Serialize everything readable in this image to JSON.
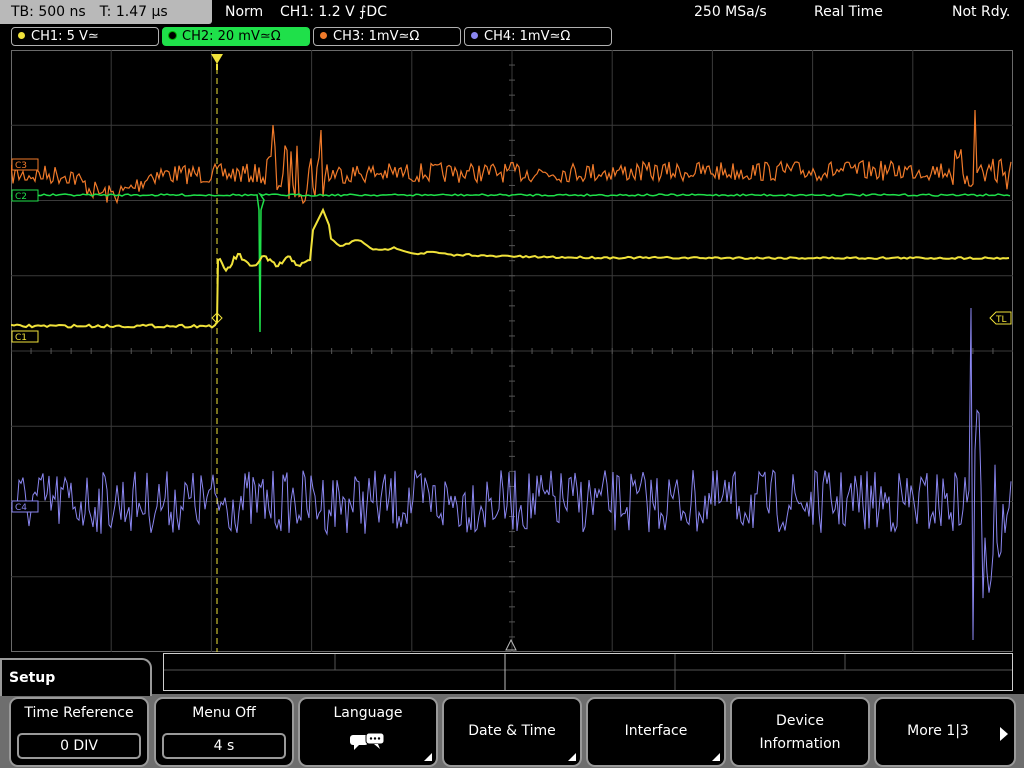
{
  "topbar": {
    "timebase": "TB: 500 ns",
    "trigger_time": "T: 1.47 µs",
    "mode": "Norm",
    "trigger": "CH1: 1.2 V ⨍DC",
    "sample_rate": "250 MSa/s",
    "acquire": "Real Time",
    "status": "Not Rdy."
  },
  "channels": [
    {
      "label": "CH1: 5 V≃",
      "color": "#f0e23a",
      "active": false
    },
    {
      "label": "CH2: 20 mV≃Ω",
      "color": "#1fe04a",
      "active": true
    },
    {
      "label": "CH3: 1mV≃Ω",
      "color": "#f07a2a",
      "active": false
    },
    {
      "label": "CH4: 1mV≃Ω",
      "color": "#8a86f0",
      "active": false
    }
  ],
  "markers": {
    "c3": "C3",
    "c2": "C2",
    "c1": "C1",
    "tl": "TL",
    "c4": "C4"
  },
  "colors": {
    "ch1": "#f0e23a",
    "ch2": "#1fe04a",
    "ch3": "#f07a2a",
    "ch4": "#8a86f0",
    "grid": "#3a3a3a",
    "trigger": "#f0e23a"
  },
  "menu": {
    "title": "Setup",
    "softkeys": [
      {
        "label": "Time Reference",
        "value": "0 DIV"
      },
      {
        "label": "Menu Off",
        "value": "4 s"
      },
      {
        "label": "Language",
        "icon": "speech-bubbles-icon"
      },
      {
        "label": "Date & Time"
      },
      {
        "label": "Interface"
      },
      {
        "label1": "Device",
        "label2": "Information"
      },
      {
        "label": "More 1|3"
      }
    ]
  }
}
